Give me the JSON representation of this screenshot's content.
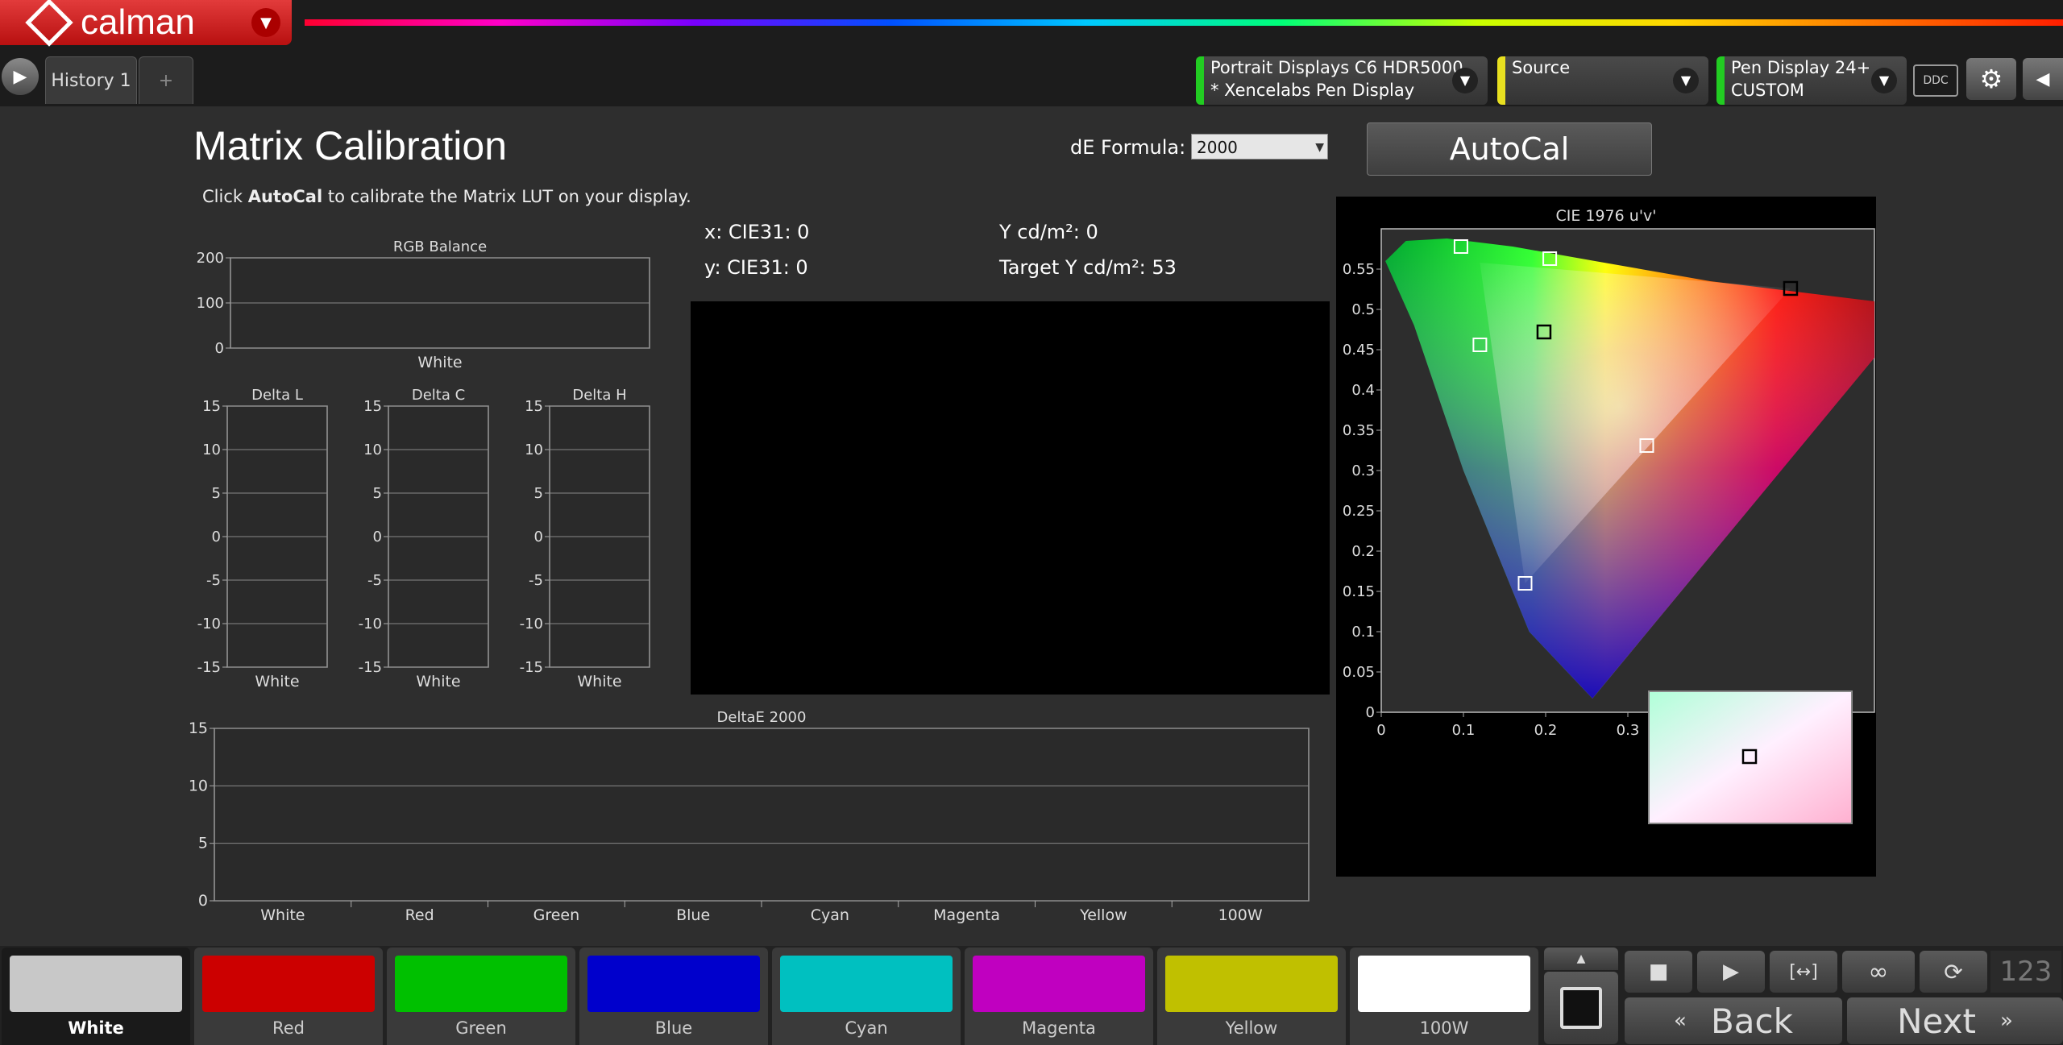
{
  "app": {
    "name": "calman"
  },
  "tabs": [
    {
      "label": "History 1"
    }
  ],
  "tab_add": "+",
  "devices": [
    {
      "line1": "Portrait Displays C6 HDR5000",
      "line2": "* Xencelabs Pen Display",
      "color": "#22cc22"
    },
    {
      "line1": "Source",
      "line2": "",
      "color": "#e8e020"
    },
    {
      "line1": "Pen Display 24+",
      "line2": "CUSTOM",
      "color": "#22cc22"
    }
  ],
  "ddc_label": "DDC",
  "page": {
    "title": "Matrix Calibration",
    "instruction_pre": "Click ",
    "instruction_bold": "AutoCal",
    "instruction_post": " to calibrate the Matrix LUT on your display.",
    "de_formula_label": "dE Formula:",
    "de_formula_value": "2000",
    "autocal_label": "AutoCal"
  },
  "readouts": {
    "x": "x: CIE31: 0",
    "y": "y: CIE31: 0",
    "Y": "Y cd/m²: 0",
    "target": "Target Y cd/m²: 53"
  },
  "chart_data": [
    {
      "type": "bar",
      "title": "RGB Balance",
      "categories": [
        "White"
      ],
      "values": [],
      "ylim": [
        0,
        200
      ],
      "yticks": [
        "0",
        "100",
        "200"
      ]
    },
    {
      "type": "bar",
      "title": "Delta L",
      "categories": [
        "White"
      ],
      "values": [],
      "ylim": [
        -15,
        15
      ],
      "yticks": [
        "-15",
        "-10",
        "-5",
        "0",
        "5",
        "10",
        "15"
      ]
    },
    {
      "type": "bar",
      "title": "Delta C",
      "categories": [
        "White"
      ],
      "values": [],
      "ylim": [
        -15,
        15
      ],
      "yticks": [
        "-15",
        "-10",
        "-5",
        "0",
        "5",
        "10",
        "15"
      ]
    },
    {
      "type": "bar",
      "title": "Delta H",
      "categories": [
        "White"
      ],
      "values": [],
      "ylim": [
        -15,
        15
      ],
      "yticks": [
        "-15",
        "-10",
        "-5",
        "0",
        "5",
        "10",
        "15"
      ]
    },
    {
      "type": "bar",
      "title": "DeltaE 2000",
      "categories": [
        "White",
        "Red",
        "Green",
        "Blue",
        "Cyan",
        "Magenta",
        "Yellow",
        "100W"
      ],
      "values": [],
      "ylim": [
        0,
        15
      ],
      "yticks": [
        "0",
        "5",
        "10",
        "15"
      ]
    },
    {
      "type": "scatter",
      "title": "CIE 1976 u'v'",
      "xlim": [
        0,
        0.6
      ],
      "ylim": [
        0,
        0.6
      ],
      "xticks": [
        "0",
        "0.1",
        "0.2",
        "0.3",
        "0.4",
        "0.5"
      ],
      "yticks": [
        "0",
        "0.05",
        "0.1",
        "0.15",
        "0.2",
        "0.25",
        "0.3",
        "0.35",
        "0.4",
        "0.45",
        "0.5",
        "0.55"
      ],
      "targets_white": [
        {
          "u": 0.097,
          "v": 0.578
        },
        {
          "u": 0.205,
          "v": 0.563
        },
        {
          "u": 0.12,
          "v": 0.456
        },
        {
          "u": 0.323,
          "v": 0.331
        },
        {
          "u": 0.175,
          "v": 0.16
        }
      ],
      "targets_black": [
        {
          "u": 0.498,
          "v": 0.526
        },
        {
          "u": 0.198,
          "v": 0.472
        }
      ]
    }
  ],
  "swatches": [
    {
      "label": "White",
      "color": "#c8c8c8"
    },
    {
      "label": "Red",
      "color": "#cc0000"
    },
    {
      "label": "Green",
      "color": "#00c000"
    },
    {
      "label": "Blue",
      "color": "#0000cc"
    },
    {
      "label": "Cyan",
      "color": "#00c0c0"
    },
    {
      "label": "Magenta",
      "color": "#c000c0"
    },
    {
      "label": "Yellow",
      "color": "#c0c000"
    },
    {
      "label": "100W",
      "color": "#ffffff"
    }
  ],
  "nav": {
    "back": "Back",
    "next": "Next",
    "counter": "123"
  }
}
